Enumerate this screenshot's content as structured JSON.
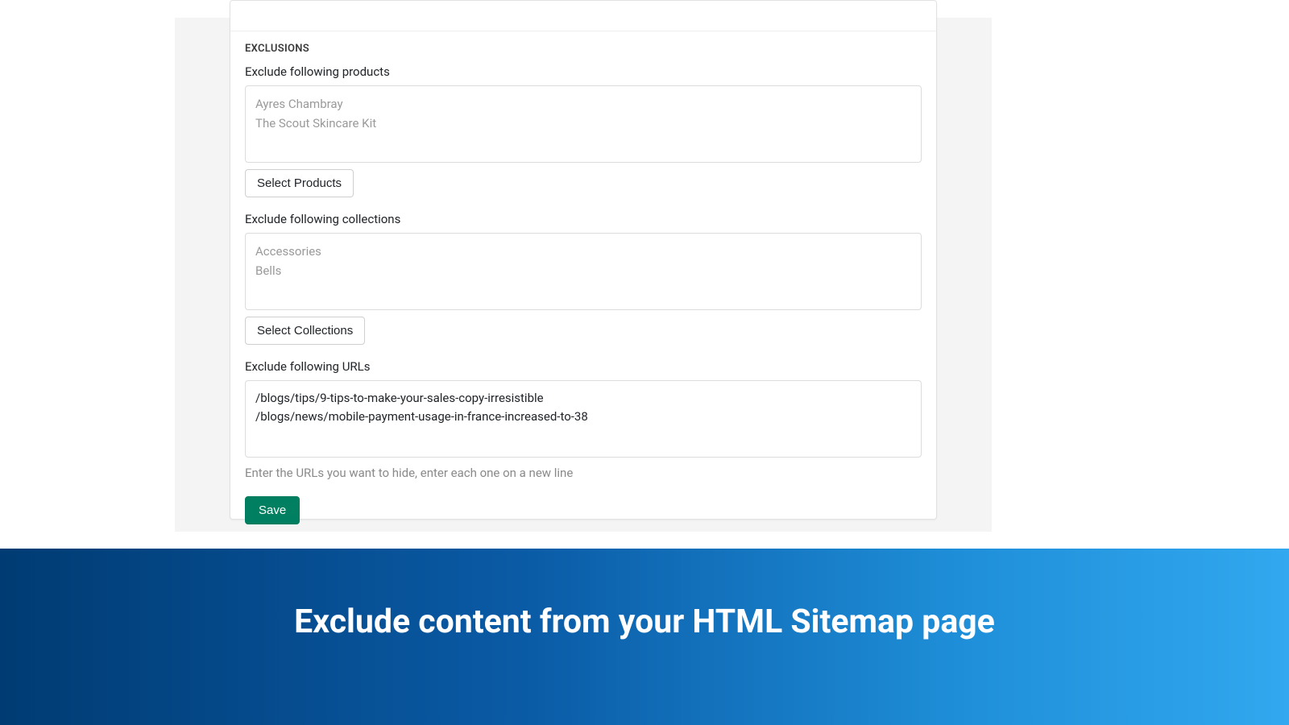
{
  "section": {
    "title": "EXCLUSIONS"
  },
  "products": {
    "label": "Exclude following products",
    "items": [
      "Ayres Chambray",
      "The Scout Skincare Kit"
    ],
    "button": "Select Products"
  },
  "collections": {
    "label": "Exclude following collections",
    "items": [
      "Accessories",
      "Bells"
    ],
    "button": "Select Collections"
  },
  "urls": {
    "label": "Exclude following URLs",
    "value": "/blogs/tips/9-tips-to-make-your-sales-copy-irresistible\n/blogs/news/mobile-payment-usage-in-france-increased-to-38",
    "help": "Enter the URLs you want to hide, enter each one on a new line"
  },
  "save": {
    "label": "Save"
  },
  "banner": {
    "text": "Exclude content from your HTML Sitemap page"
  }
}
